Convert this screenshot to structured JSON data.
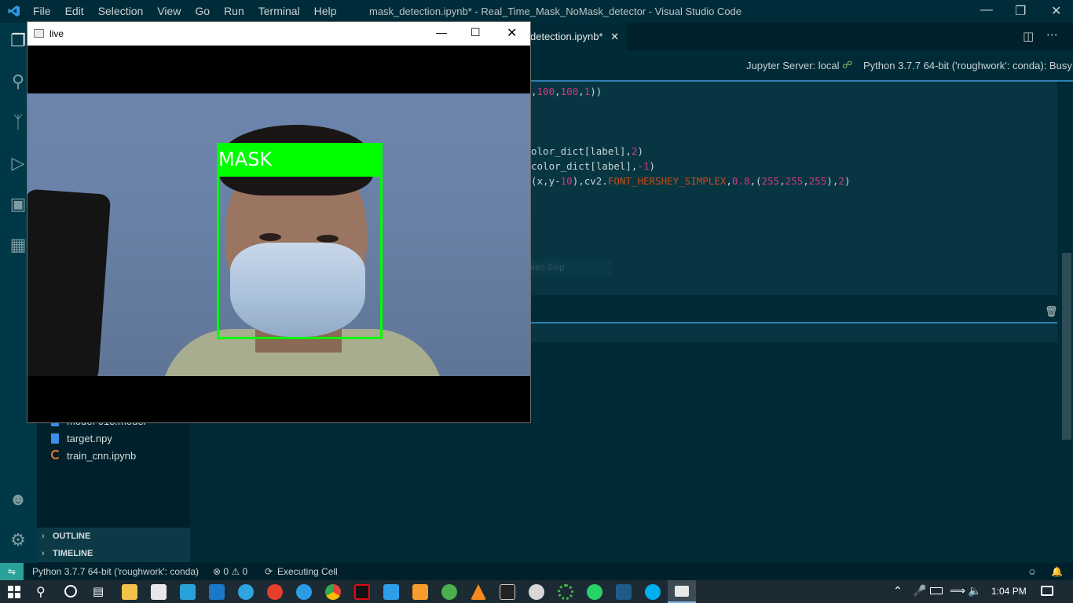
{
  "titlebar": {
    "menu": [
      "File",
      "Edit",
      "Selection",
      "View",
      "Go",
      "Run",
      "Terminal",
      "Help"
    ],
    "window_title": "mask_detection.ipynb* - Real_Time_Mask_NoMask_detector - Visual Studio Code"
  },
  "editor": {
    "active_tab": "detection.ipynb*",
    "jupyter_server": "Jupyter Server: local",
    "kernel": "Python 3.7.7 64-bit ('roughwork': conda): Busy",
    "code": {
      "line1_pre": ",",
      "line1_n1": "100",
      "line1_c1": ",",
      "line1_n2": "100",
      "line1_c2": ",",
      "line1_n3": "1",
      "line1_end": "))",
      "line2_pre": "olor_dict[label],",
      "line2_n": "2",
      "line2_end": ")",
      "line3_pre": "color_dict[label],",
      "line3_n": "-1",
      "line3_end": ")",
      "line4_a": "(x,y-",
      "line4_n1": "10",
      "line4_b": "),cv2.",
      "line4_const": "FONT_HERSHEY_SIMPLEX",
      "line4_c": ",",
      "line4_n2": "0.8",
      "line4_d": ",(",
      "line4_n3": "255",
      "line4_e": ",",
      "line4_n4": "255",
      "line4_f": ",",
      "line4_n5": "255",
      "line4_g": "),",
      "line4_n6": "2",
      "line4_h": ")"
    },
    "snip_text": "Full-screen Snip"
  },
  "live_window": {
    "title": "live",
    "label": "MASK"
  },
  "sidebar": {
    "files": [
      "model-018.model",
      "target.npy",
      "train_cnn.ipynb"
    ],
    "sections": [
      "OUTLINE",
      "TIMELINE"
    ]
  },
  "statusbar": {
    "interpreter": "Python 3.7.7 64-bit ('roughwork': conda)",
    "problems": "⊗ 0 ⚠ 0",
    "status": "Executing Cell"
  },
  "taskbar": {
    "time": "1:04 PM"
  },
  "colors": {
    "accent_green": "#00ff00",
    "status_remote": "#2aa198",
    "number": "#d33682",
    "constant": "#cb4b16"
  }
}
